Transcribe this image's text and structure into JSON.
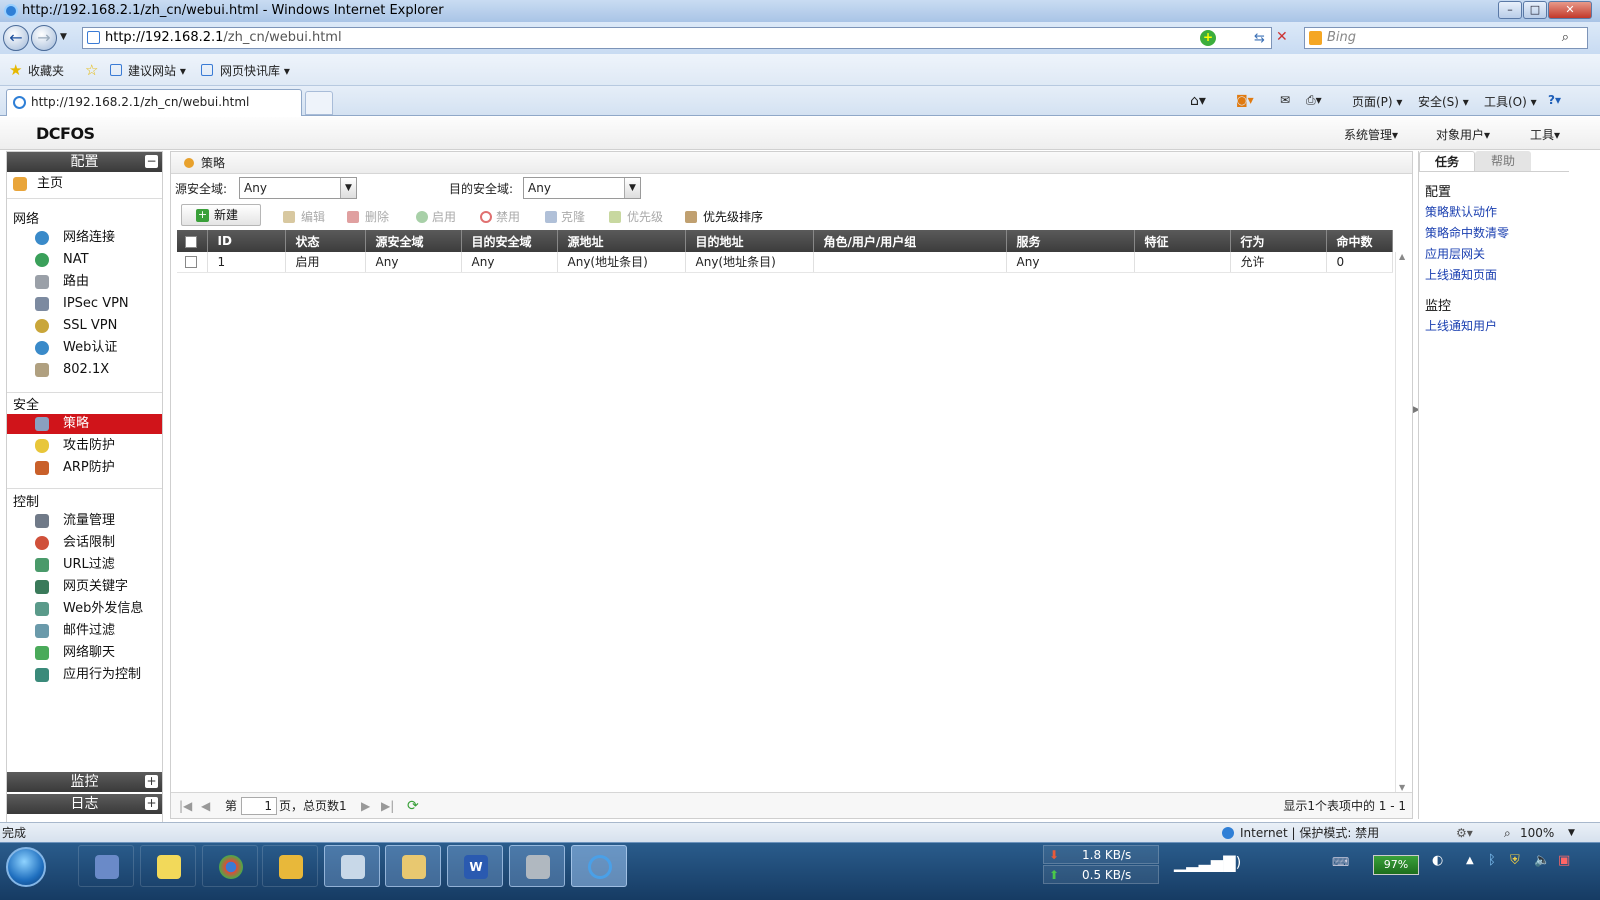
{
  "window": {
    "title": "http://192.168.2.1/zh_cn/webui.html - Windows Internet Explorer"
  },
  "browser": {
    "url_host": "http://192.168.2.1",
    "url_path": "/zh_cn/webui.html",
    "search_placeholder": "Bing",
    "favorites": [
      "收藏夹",
      "建议网站 ▾",
      "网页快讯库 ▾"
    ],
    "tab_title": "http://192.168.2.1/zh_cn/webui.html",
    "commands": [
      "页面(P) ▾",
      "安全(S) ▾",
      "工具(O) ▾"
    ],
    "status": "完成",
    "zone": "Internet | 保护模式: 禁用",
    "zoom": "100%"
  },
  "app": {
    "logo": "DCFOS",
    "menus": [
      "系统管理▾",
      "对象用户▾",
      "工具▾"
    ]
  },
  "sidebar": {
    "config_title": "配置",
    "home": "主页",
    "sections": [
      {
        "title": "网络",
        "items": [
          "网络连接",
          "NAT",
          "路由",
          "IPSec VPN",
          "SSL VPN",
          "Web认证",
          "802.1X"
        ]
      },
      {
        "title": "安全",
        "items": [
          "策略",
          "攻击防护",
          "ARP防护"
        ]
      },
      {
        "title": "控制",
        "items": [
          "流量管理",
          "会话限制",
          "URL过滤",
          "网页关键字",
          "Web外发信息",
          "邮件过滤",
          "网络聊天",
          "应用行为控制"
        ]
      }
    ],
    "active_item": "策略",
    "monitor_title": "监控",
    "log_title": "日志"
  },
  "main": {
    "breadcrumb": "策略",
    "src_zone_label": "源安全域:",
    "src_zone_value": "Any",
    "dst_zone_label": "目的安全域:",
    "dst_zone_value": "Any",
    "toolbar": {
      "new": "新建",
      "edit": "编辑",
      "delete": "删除",
      "enable": "启用",
      "disable": "禁用",
      "clone": "克隆",
      "priority": "优先级",
      "priority_sort": "优先级排序"
    },
    "table": {
      "columns": [
        "ID",
        "状态",
        "源安全域",
        "目的安全域",
        "源地址",
        "目的地址",
        "角色/用户/用户组",
        "服务",
        "特征",
        "行为",
        "命中数"
      ],
      "rows": [
        [
          "1",
          "启用",
          "Any",
          "Any",
          "Any(地址条目)",
          "Any(地址条目)",
          "",
          "Any",
          "",
          "允许",
          "0"
        ]
      ]
    },
    "pager": {
      "page_prefix": "第",
      "page_value": "1",
      "page_suffix": "页，总页数1",
      "summary": "显示1个表项中的 1 - 1"
    }
  },
  "rightpanel": {
    "tabs": [
      "任务",
      "帮助"
    ],
    "config_title": "配置",
    "config_links": [
      "策略默认动作",
      "策略命中数清零",
      "应用层网关",
      "上线通知页面"
    ],
    "monitor_title": "监控",
    "monitor_links": [
      "上线通知用户"
    ]
  },
  "taskbar": {
    "download_speed": "1.8 KB/s",
    "upload_speed": "0.5 KB/s",
    "battery": "97%"
  }
}
